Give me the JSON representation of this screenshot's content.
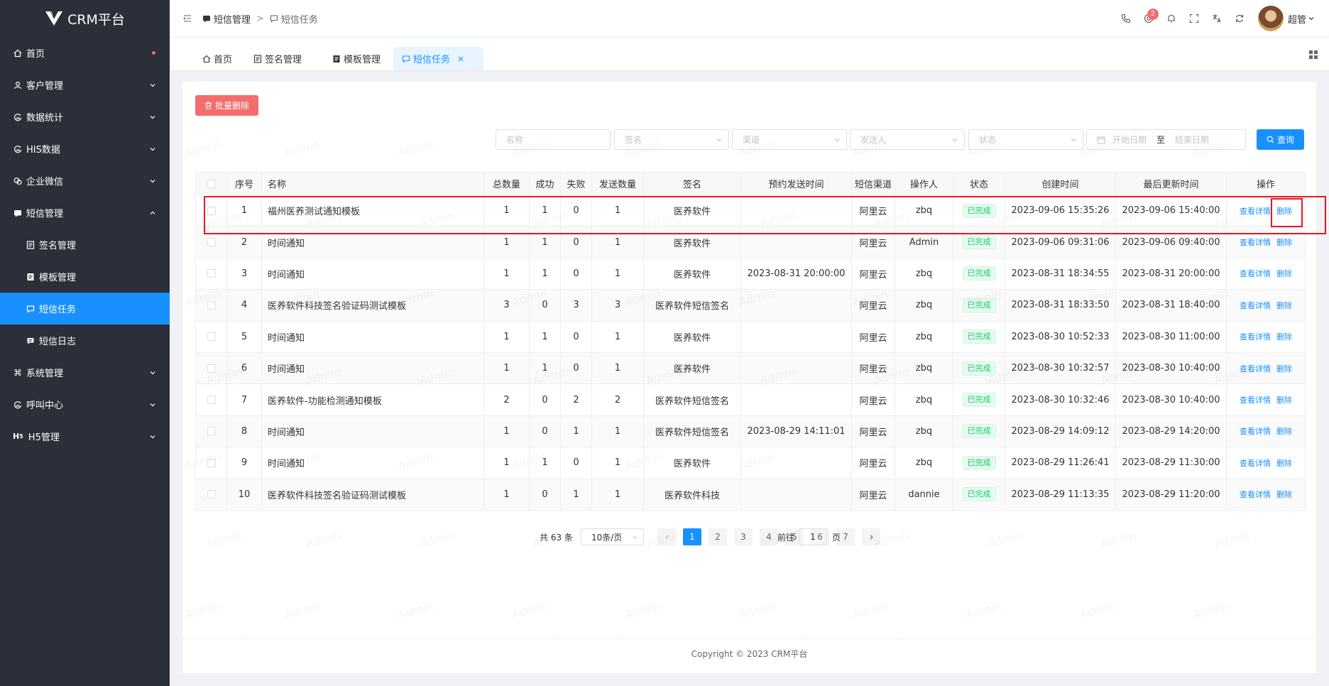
{
  "app": {
    "title": "CRM平台",
    "watermark": "Admin",
    "accent": "#1890ff",
    "sidebar_bg": "#2b2f3a",
    "danger": "#f56c6c"
  },
  "sidebar": {
    "items": [
      {
        "label": "首页",
        "icon": "home-icon"
      },
      {
        "label": "客户管理",
        "icon": "user-icon"
      },
      {
        "label": "数据统计",
        "icon": "refresh-chart-icon"
      },
      {
        "label": "HIS数据",
        "icon": "refresh-chart-icon"
      },
      {
        "label": "企业微信",
        "icon": "wechat-icon"
      },
      {
        "label": "短信管理",
        "icon": "message-icon"
      },
      {
        "label": "签名管理",
        "icon": "document-icon"
      },
      {
        "label": "模板管理",
        "icon": "template-icon"
      },
      {
        "label": "短信任务",
        "icon": "chat-icon"
      },
      {
        "label": "短信日志",
        "icon": "message-log-icon"
      },
      {
        "label": "系统管理",
        "icon": "command-icon"
      },
      {
        "label": "呼叫中心",
        "icon": "refresh-chart-icon"
      },
      {
        "label": "H5管理",
        "icon": "h5-icon"
      }
    ]
  },
  "header": {
    "breadcrumb": [
      "短信管理",
      "短信任务"
    ],
    "breadcrumb_sep": ">",
    "notification_count": "2",
    "user_name": "超管"
  },
  "tags": [
    {
      "label": "首页"
    },
    {
      "label": "签名管理"
    },
    {
      "label": "模板管理"
    },
    {
      "label": "短信任务",
      "close": "×"
    }
  ],
  "toolbar": {
    "batch_delete": "批量删除",
    "query": "查询"
  },
  "filters": {
    "name_placeholder": "名称",
    "sign_placeholder": "签名",
    "channel_placeholder": "渠道",
    "sender_placeholder": "发送人",
    "status_placeholder": "状态",
    "start_date_placeholder": "开始日期",
    "date_sep": "至",
    "end_date_placeholder": "结束日期"
  },
  "table": {
    "columns": [
      "序号",
      "名称",
      "总数量",
      "成功",
      "失败",
      "发送数量",
      "签名",
      "预约发送时间",
      "短信渠道",
      "操作人",
      "状态",
      "创建时间",
      "最后更新时间",
      "操作"
    ],
    "action_view": "查看详情",
    "action_delete": "删除",
    "rows": [
      {
        "no": "1",
        "name": "福州医养测试通知模板",
        "total": "1",
        "success": "1",
        "fail": "0",
        "sent": "1",
        "sign": "医养软件",
        "scheduled": "",
        "channel": "阿里云",
        "operator": "zbq",
        "status": "已完成",
        "created": "2023-09-06 15:35:26",
        "updated": "2023-09-06 15:40:00"
      },
      {
        "no": "2",
        "name": "时间通知",
        "total": "1",
        "success": "1",
        "fail": "0",
        "sent": "1",
        "sign": "医养软件",
        "scheduled": "",
        "channel": "阿里云",
        "operator": "Admin",
        "status": "已完成",
        "created": "2023-09-06 09:31:06",
        "updated": "2023-09-06 09:40:00"
      },
      {
        "no": "3",
        "name": "时间通知",
        "total": "1",
        "success": "1",
        "fail": "0",
        "sent": "1",
        "sign": "医养软件",
        "scheduled": "2023-08-31 20:00:00",
        "channel": "阿里云",
        "operator": "zbq",
        "status": "已完成",
        "created": "2023-08-31 18:34:55",
        "updated": "2023-08-31 20:00:00"
      },
      {
        "no": "4",
        "name": "医养软件科技签名验证码测试模板",
        "total": "3",
        "success": "0",
        "fail": "3",
        "sent": "3",
        "sign": "医养软件短信签名",
        "scheduled": "",
        "channel": "阿里云",
        "operator": "zbq",
        "status": "已完成",
        "created": "2023-08-31 18:33:50",
        "updated": "2023-08-31 18:40:00"
      },
      {
        "no": "5",
        "name": "时间通知",
        "total": "1",
        "success": "1",
        "fail": "0",
        "sent": "1",
        "sign": "医养软件",
        "scheduled": "",
        "channel": "阿里云",
        "operator": "zbq",
        "status": "已完成",
        "created": "2023-08-30 10:52:33",
        "updated": "2023-08-30 11:00:00"
      },
      {
        "no": "6",
        "name": "时间通知",
        "total": "1",
        "success": "1",
        "fail": "0",
        "sent": "1",
        "sign": "医养软件",
        "scheduled": "",
        "channel": "阿里云",
        "operator": "zbq",
        "status": "已完成",
        "created": "2023-08-30 10:32:57",
        "updated": "2023-08-30 10:40:00"
      },
      {
        "no": "7",
        "name": "医养软件-功能检测通知模板",
        "total": "2",
        "success": "0",
        "fail": "2",
        "sent": "2",
        "sign": "医养软件短信签名",
        "scheduled": "",
        "channel": "阿里云",
        "operator": "zbq",
        "status": "已完成",
        "created": "2023-08-30 10:32:46",
        "updated": "2023-08-30 10:40:00"
      },
      {
        "no": "8",
        "name": "时间通知",
        "total": "1",
        "success": "0",
        "fail": "1",
        "sent": "1",
        "sign": "医养软件短信签名",
        "scheduled": "2023-08-29 14:11:01",
        "channel": "阿里云",
        "operator": "zbq",
        "status": "已完成",
        "created": "2023-08-29 14:09:12",
        "updated": "2023-08-29 14:20:00"
      },
      {
        "no": "9",
        "name": "时间通知",
        "total": "1",
        "success": "1",
        "fail": "0",
        "sent": "1",
        "sign": "医养软件",
        "scheduled": "",
        "channel": "阿里云",
        "operator": "zbq",
        "status": "已完成",
        "created": "2023-08-29 11:26:41",
        "updated": "2023-08-29 11:30:00"
      },
      {
        "no": "10",
        "name": "医养软件科技签名验证码测试模板",
        "total": "1",
        "success": "0",
        "fail": "1",
        "sent": "1",
        "sign": "医养软件科技",
        "scheduled": "",
        "channel": "阿里云",
        "operator": "dannie",
        "status": "已完成",
        "created": "2023-08-29 11:13:35",
        "updated": "2023-08-29 11:20:00"
      }
    ]
  },
  "pagination": {
    "total": "共 63 条",
    "page_size": "10条/页",
    "pages": [
      "1",
      "2",
      "3",
      "4",
      "5",
      "6",
      "7"
    ],
    "current": "1",
    "jump_label": "前往",
    "jump_value": "1",
    "page_suffix": "页"
  },
  "footer": {
    "copyright": "Copyright ©  2023 CRM平台"
  }
}
